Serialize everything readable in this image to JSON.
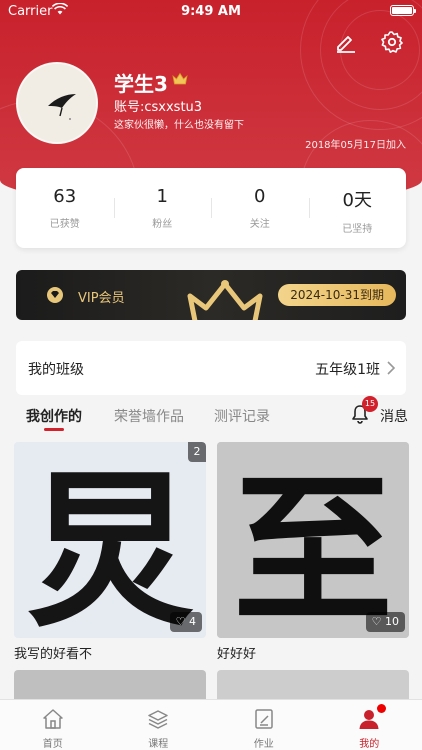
{
  "status_bar": {
    "carrier": "Carrier",
    "time": "9:49 AM"
  },
  "profile": {
    "name": "学生3",
    "account": "账号:csxxstu3",
    "bio": "这家伙很懒，什么也没有留下",
    "joined": "2018年05月17日加入"
  },
  "stats": [
    {
      "value": "63",
      "label": "已获赞"
    },
    {
      "value": "1",
      "label": "粉丝"
    },
    {
      "value": "0",
      "label": "关注"
    },
    {
      "value": "0天",
      "label": "已坚持"
    }
  ],
  "vip": {
    "label": "VIP会员",
    "expiry": "2024-10-31到期"
  },
  "class_row": {
    "label": "我的班级",
    "value": "五年级1班"
  },
  "tabs": [
    {
      "label": "我创作的"
    },
    {
      "label": "荣誉墙作品"
    },
    {
      "label": "测评记录"
    }
  ],
  "messages": {
    "label": "消息",
    "badge": "15"
  },
  "works": [
    {
      "title": "我写的好看不",
      "count": "2",
      "likes": "4",
      "character": "炅"
    },
    {
      "title": "好好好",
      "likes": "10",
      "character": "至"
    }
  ],
  "bottom_nav": [
    {
      "label": "首页",
      "icon": "home-icon"
    },
    {
      "label": "课程",
      "icon": "layers-icon"
    },
    {
      "label": "作业",
      "icon": "homework-icon"
    },
    {
      "label": "我的",
      "icon": "user-icon"
    }
  ],
  "colors": {
    "brand_red": "#c8212c",
    "vip_gold": "#e8c77a"
  }
}
